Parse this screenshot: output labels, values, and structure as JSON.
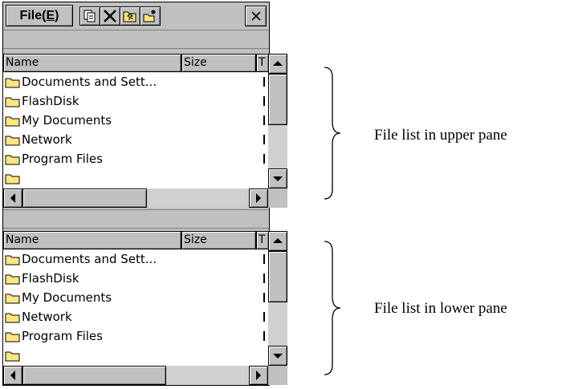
{
  "menu": {
    "file_label": "File(E)"
  },
  "toolbar": {
    "icons": [
      "copy-icon",
      "delete-icon",
      "up-folder-icon",
      "new-folder-icon"
    ],
    "close_symbol": "×"
  },
  "columns": {
    "name": "Name",
    "size": "Size",
    "type": "T"
  },
  "upper_pane": {
    "items": [
      "Documents and Sett...",
      "FlashDisk",
      "My Documents",
      "Network",
      "Program Files"
    ]
  },
  "lower_pane": {
    "items": [
      "Documents and Sett...",
      "FlashDisk",
      "My Documents",
      "Network",
      "Program Files"
    ]
  },
  "annotations": {
    "upper": "File list in upper pane",
    "lower": "File list in lower pane"
  },
  "colors": {
    "chrome": "#c0c0c0",
    "folder": "#ffe680",
    "folder_outline": "#000000"
  }
}
